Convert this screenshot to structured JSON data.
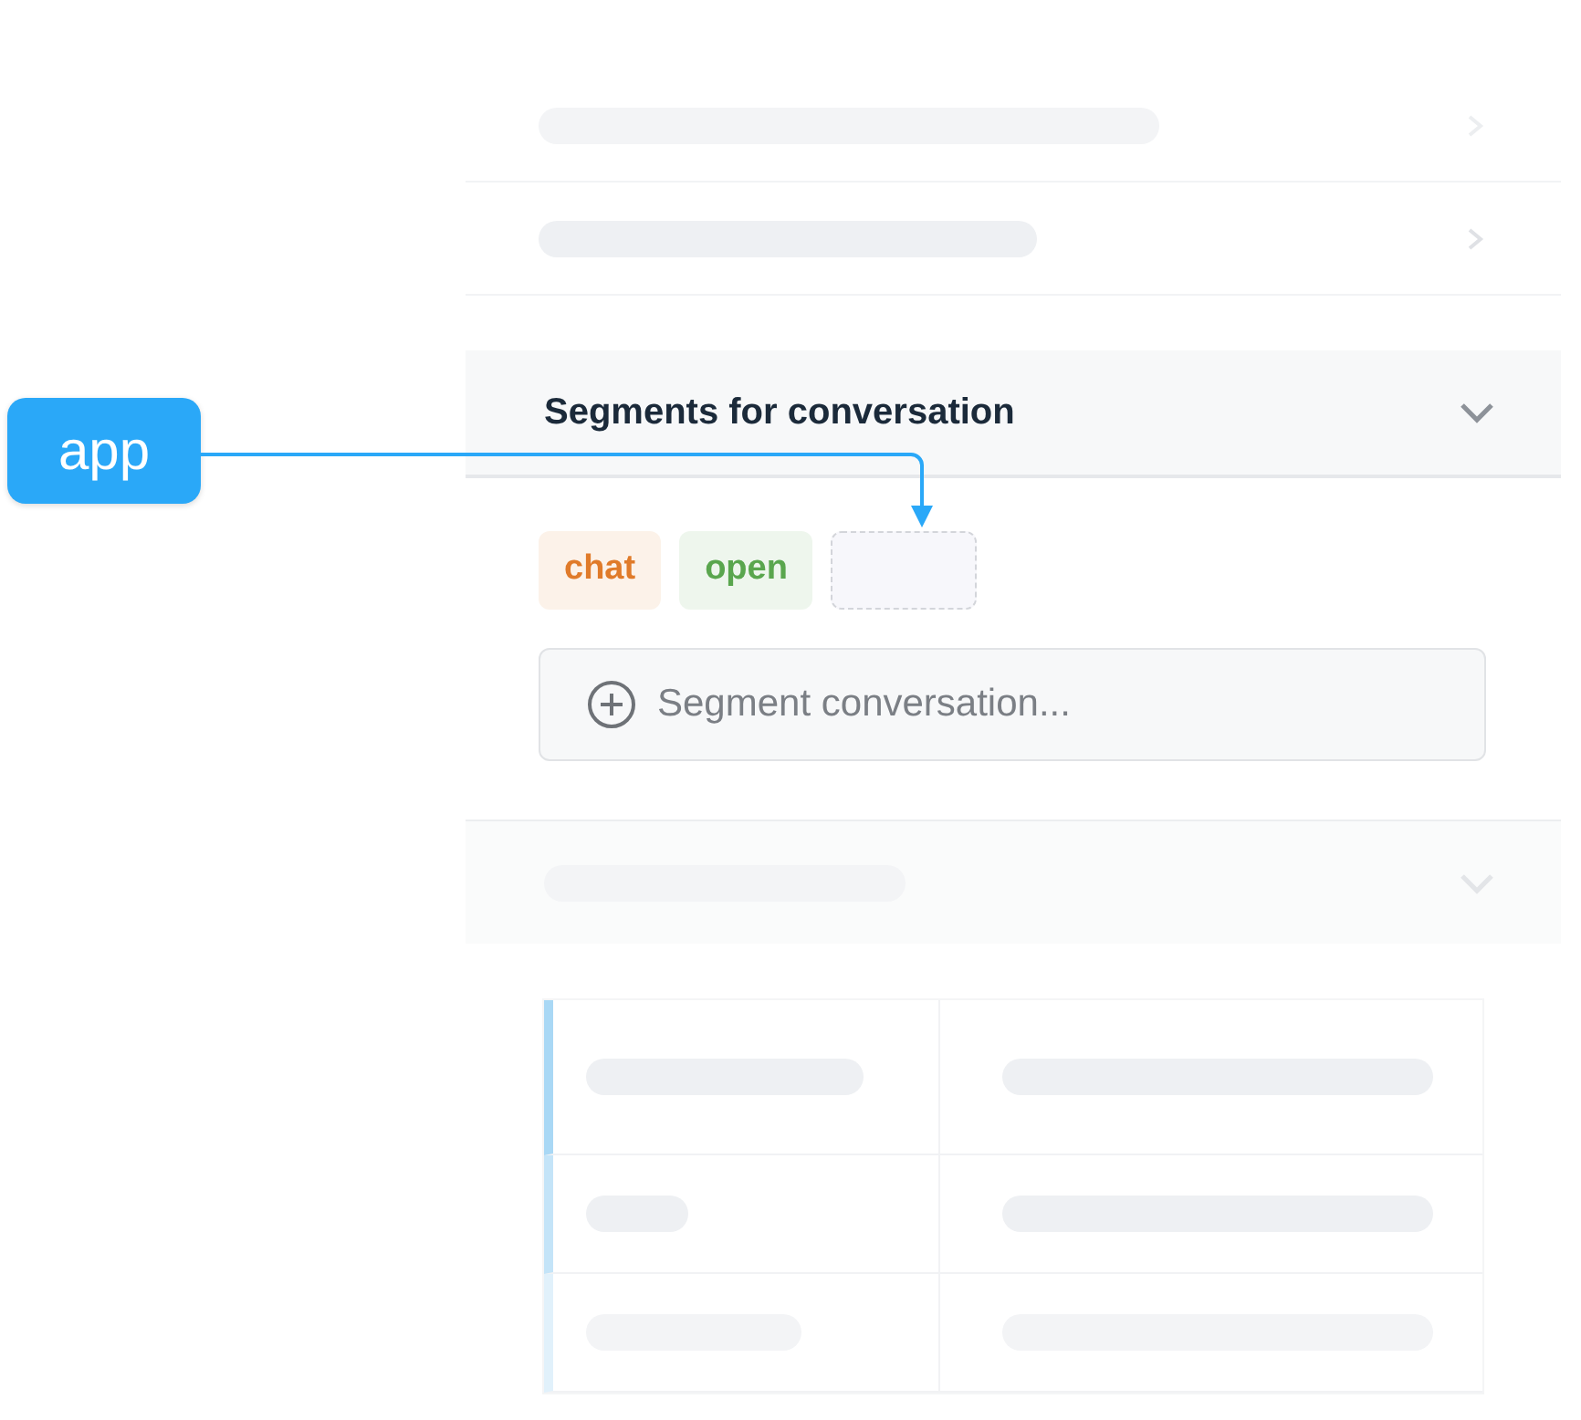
{
  "callout": {
    "label": "app"
  },
  "section": {
    "title": "Segments for conversation"
  },
  "tags": [
    {
      "kind": "tag",
      "label": "chat",
      "color": "#e07b2a"
    },
    {
      "kind": "tag",
      "label": "open",
      "color": "#5aa64e"
    },
    {
      "kind": "empty"
    }
  ],
  "segment_input": {
    "placeholder": "Segment conversation..."
  }
}
